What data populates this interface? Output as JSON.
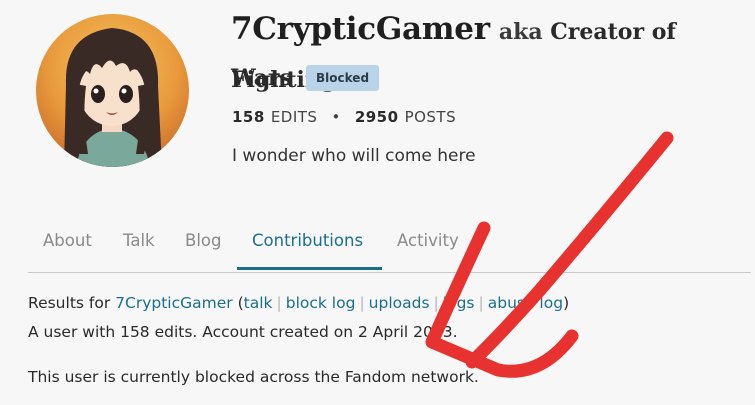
{
  "profile": {
    "username": "7CrypticGamer",
    "aka_prefix": "aka",
    "aka_name_part1": "Creator of Fighting",
    "aka_name_part2": "Wars",
    "status_badge": "Blocked",
    "edits_count": "158",
    "edits_label": "EDITS",
    "stats_separator": "•",
    "posts_count": "2950",
    "posts_label": "POSTS",
    "bio": "I wonder who will come here"
  },
  "tabs": [
    {
      "label": "About"
    },
    {
      "label": "Talk"
    },
    {
      "label": "Blog"
    },
    {
      "label": "Contributions"
    },
    {
      "label": "Activity"
    }
  ],
  "active_tab": "Contributions",
  "contributions": {
    "results_prefix": "Results for",
    "user_link": "7CrypticGamer",
    "open_paren": "(",
    "close_paren": ")",
    "links": [
      "talk",
      "block log",
      "uploads",
      "logs",
      "abuse log"
    ],
    "summary": "A user with 158 edits. Account created on 2 April 2013.",
    "block_notice": "This user is currently blocked across the Fandom network."
  },
  "colors": {
    "accent": "#1a6f8e",
    "badge_bg": "#b9d4e8",
    "annotation_red": "#e8322f"
  }
}
